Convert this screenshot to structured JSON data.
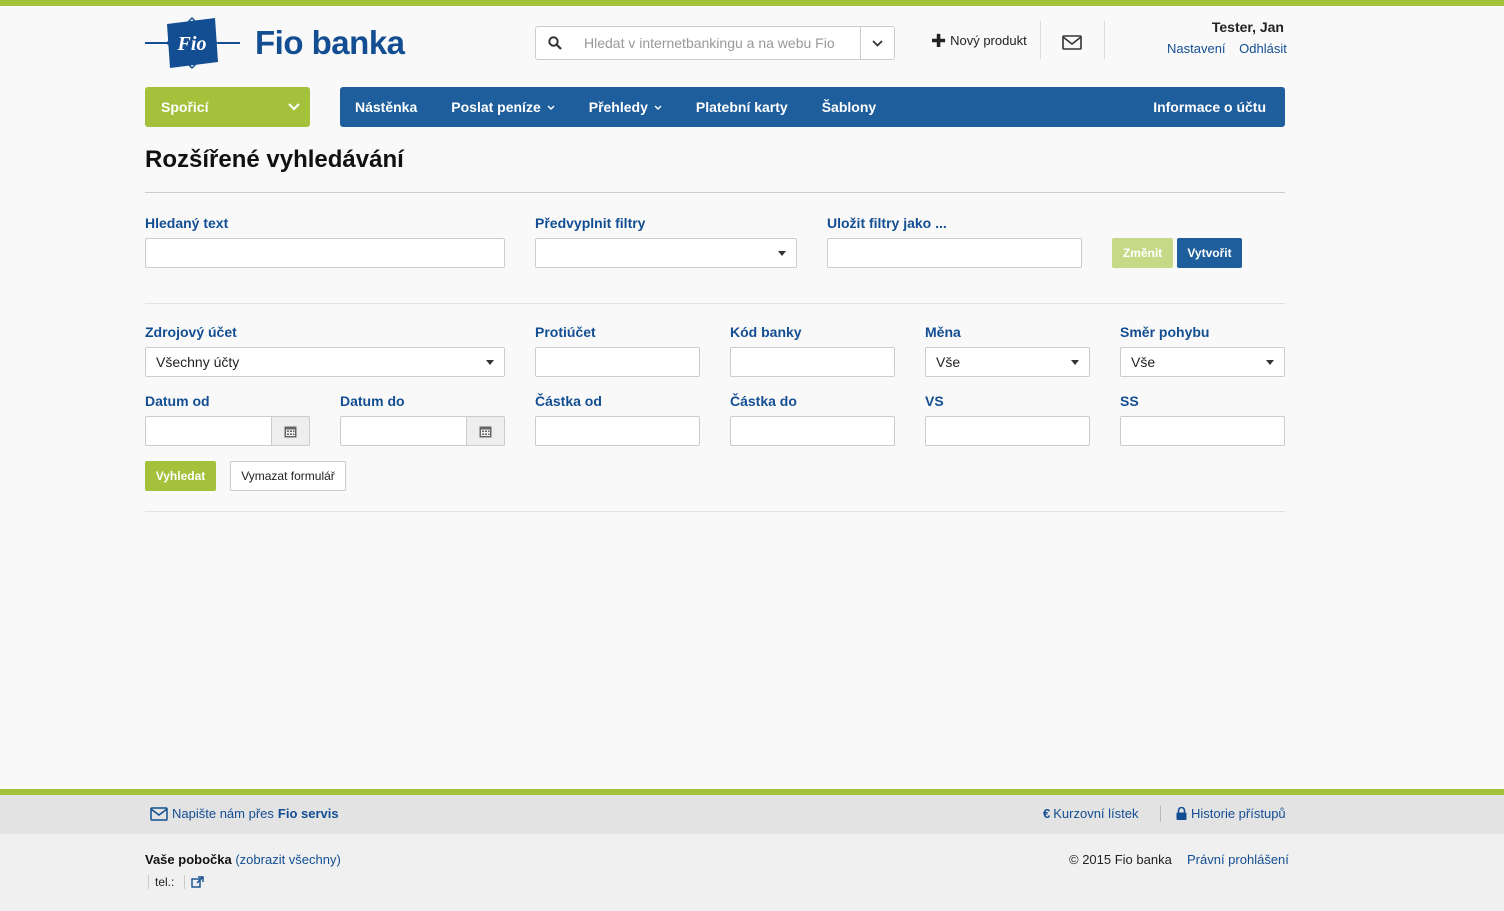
{
  "brand": {
    "logo_mark": "Fio",
    "name": "Fio banka"
  },
  "header": {
    "search_placeholder": "Hledat v internetbankingu a na webu Fio",
    "new_product": "Nový produkt",
    "user_name": "Tester, Jan",
    "settings": "Nastavení",
    "logout": "Odhlásit"
  },
  "nav": {
    "product": "Spořicí",
    "items": [
      {
        "label": "Nástěnka",
        "dropdown": false
      },
      {
        "label": "Poslat peníze",
        "dropdown": true
      },
      {
        "label": "Přehledy",
        "dropdown": true
      },
      {
        "label": "Platební karty",
        "dropdown": false
      },
      {
        "label": "Šablony",
        "dropdown": false
      }
    ],
    "account_info": "Informace o účtu"
  },
  "page": {
    "title": "Rozšířené vyhledávání"
  },
  "filters_top": {
    "search_text_label": "Hledaný text",
    "search_text_value": "",
    "prefill_label": "Předvyplnit filtry",
    "prefill_value": "",
    "save_as_label": "Uložit filtry jako ...",
    "save_as_value": "",
    "change_button": "Změnit",
    "create_button": "Vytvořit"
  },
  "filters": {
    "source_account_label": "Zdrojový účet",
    "source_account_value": "Všechny účty",
    "counter_account_label": "Protiúčet",
    "bank_code_label": "Kód banky",
    "currency_label": "Měna",
    "currency_value": "Vše",
    "direction_label": "Směr pohybu",
    "direction_value": "Vše",
    "date_from_label": "Datum od",
    "date_to_label": "Datum do",
    "amount_from_label": "Částka od",
    "amount_to_label": "Částka do",
    "vs_label": "VS",
    "ss_label": "SS",
    "search_button": "Vyhledat",
    "clear_button": "Vymazat formulář"
  },
  "footer": {
    "write_us": "Napište nám přes",
    "fio_servis": "Fio servis",
    "exchange_rates": "Kurzovní lístek",
    "access_history": "Historie přístupů",
    "branch_label": "Vaše pobočka",
    "show_all": "(zobrazit všechny)",
    "tel": "tel.:",
    "copyright": "© 2015 Fio banka",
    "legal": "Právní prohlášení"
  },
  "colors": {
    "green": "#a3c13a",
    "blue": "#1f5e9c",
    "dark_blue": "#134e92"
  }
}
